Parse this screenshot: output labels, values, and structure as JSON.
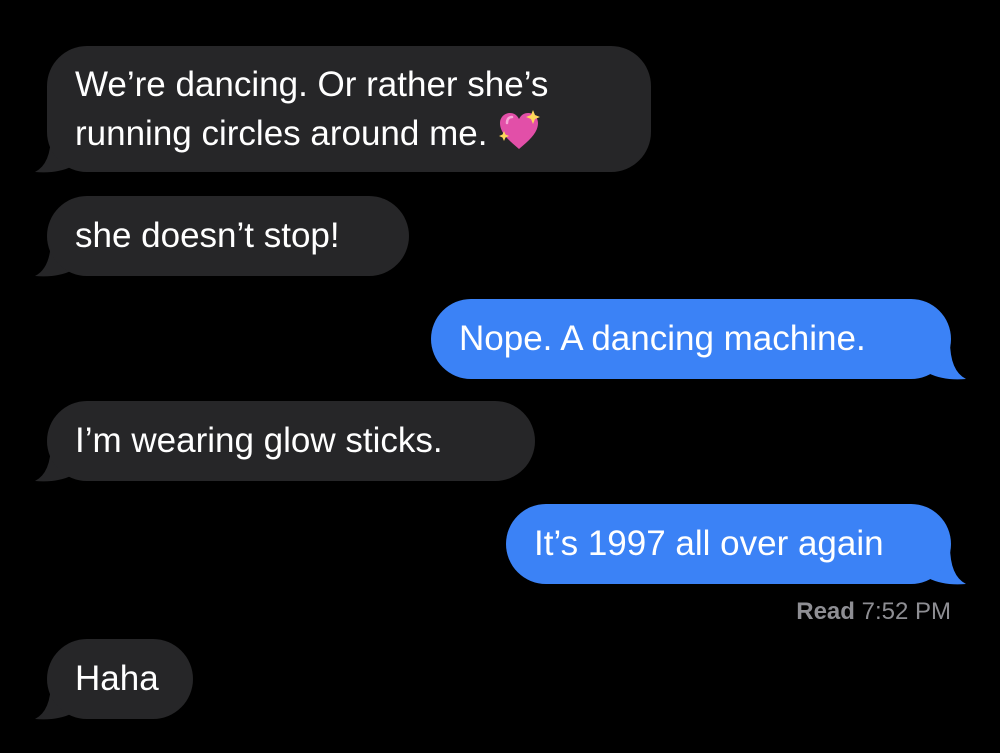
{
  "colors": {
    "background": "#000000",
    "incoming_bubble": "#262628",
    "outgoing_bubble": "#3b82f6",
    "text": "#ffffff",
    "receipt": "#8e8e93"
  },
  "messages": [
    {
      "direction": "incoming",
      "lines": [
        "We’re dancing. Or rather she’s",
        "running circles around me."
      ],
      "emoji": "sparkling-heart-icon"
    },
    {
      "direction": "incoming",
      "text": "she doesn’t stop!"
    },
    {
      "direction": "outgoing",
      "text": "Nope. A dancing machine."
    },
    {
      "direction": "incoming",
      "text": "I’m wearing glow sticks."
    },
    {
      "direction": "outgoing",
      "text": "It’s 1997 all over again"
    },
    {
      "direction": "incoming",
      "text": "Haha"
    }
  ],
  "read_receipt": {
    "label": "Read",
    "time": "7:52 PM"
  }
}
